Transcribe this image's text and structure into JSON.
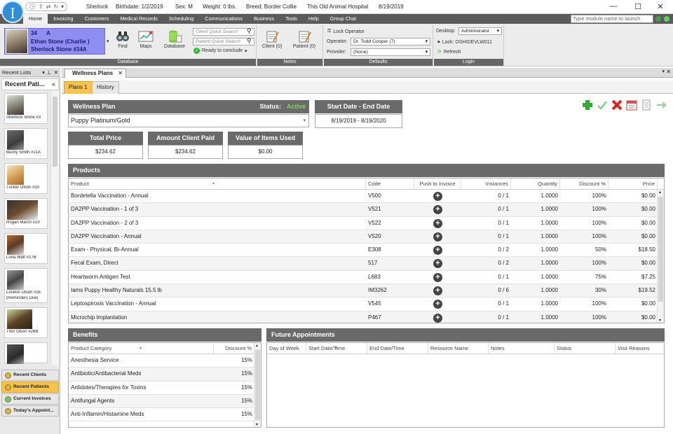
{
  "titlebar": {
    "logo": "I",
    "patient": "Sherlock",
    "birthdate": "Birthdate: 1/2/2019",
    "sex": "Sex: M",
    "weight": "Weight: 0 lbs.",
    "breed": "Breed: Border Collie",
    "hospital": "This Old Animal Hospital",
    "date": "8/19/2019",
    "minimize": "—",
    "maximize": "☐",
    "close": "✕"
  },
  "menu": {
    "items": [
      "Home",
      "Invoicing",
      "Customers",
      "Medical Records",
      "Scheduling",
      "Communications",
      "Business",
      "Tools",
      "Help",
      "Group Chat"
    ],
    "search_placeholder": "Type module name to launch"
  },
  "ribbon": {
    "patient_card": {
      "id": "34",
      "letter": "A",
      "client": "Ethan Stone (Charlie )",
      "patient": "Sherlock Stone #34A"
    },
    "find": "Find",
    "maps": "Maps",
    "database": "Database",
    "client_quick_search": "Client Quick Search",
    "patient_quick_search": "Patient Quick Search",
    "ready": "Ready to conclude",
    "database_group": "Database",
    "client_note": "Client (0)",
    "patient_note": "Patient (0)",
    "notes_group": "Notes",
    "lock_operator": "Lock Operator",
    "operator_label": "Operator:",
    "operator_value": "Dr. Todd Cooper (7)",
    "provider_label": "Provider:",
    "provider_value": "(None)",
    "defaults_group": "Defaults",
    "desktop_label": "Desktop:",
    "desktop_value": "Administrator",
    "lock_machine": "Lock: OSHIDEVLW011",
    "refresh": "Refresh",
    "login_group": "Login"
  },
  "left": {
    "recent_lists": "Recent Lists",
    "recent_patients_title": "Recent Pati...",
    "patients": [
      "Sherlock Stone #3",
      "Bucky Smith #21A",
      "Tucker Olson #20",
      "Rogan March #23",
      "Luna Watt #27B",
      "London Olson #2E",
      "Thor Olson #26B"
    ],
    "reminders": "(Reminders Due)",
    "nav": [
      "Recent Clients",
      "Recent Patients",
      "Current Invoices",
      "Today's Appoint..."
    ]
  },
  "doc": {
    "tab": "Wellness Plans",
    "subtabs": [
      "Plans 1",
      "History"
    ]
  },
  "plan": {
    "header": "Wellness Plan",
    "status_label": "Status:",
    "status_value": "Active",
    "plan_name": "Puppy Platinum/Gold",
    "dates_header": "Start Date - End Date",
    "dates": "8/19/2019 - 8/19/2020",
    "total_price_label": "Total Price",
    "total_price": "$234.62",
    "amount_paid_label": "Amount Client Paid",
    "amount_paid": "$234.62",
    "items_used_label": "Value of Items Used",
    "items_used": "$0.00"
  },
  "colors": {
    "status_active": "#7ed957",
    "accent_orange": "#f9c24a",
    "header_gray": "#6a6a6a"
  },
  "products": {
    "title": "Products",
    "columns": [
      "Product",
      "Code",
      "Push to Invoice",
      "Instances",
      "Quantity",
      "Discount %",
      "Price"
    ],
    "rows": [
      [
        "Bordetella Vaccination - Annual",
        "V500",
        "0 / 1",
        "1.0000",
        "100%",
        "$0.00"
      ],
      [
        "DA2PP Vaccination - 1 of 3",
        "V521",
        "0 / 1",
        "1.0000",
        "100%",
        "$0.00"
      ],
      [
        "DA2PP Vaccination - 2 of 3",
        "V522",
        "0 / 1",
        "1.0000",
        "100%",
        "$0.00"
      ],
      [
        "DA2PP Vaccination - Annual",
        "V520",
        "0 / 1",
        "1.0000",
        "100%",
        "$0.00"
      ],
      [
        "Exam - Physical, Bi-Annual",
        "E308",
        "0 / 2",
        "1.0000",
        "50%",
        "$18.50"
      ],
      [
        "Fecal Exam, Direct",
        "517",
        "0 / 2",
        "1.0000",
        "100%",
        "$0.00"
      ],
      [
        "Heartworm Antigen Test",
        "L683",
        "0 / 1",
        "1.0000",
        "75%",
        "$7.25"
      ],
      [
        "Iams Puppy Healthy Naturals 15.5 lb",
        "IM3262",
        "0 / 6",
        "1.0000",
        "30%",
        "$19.52"
      ],
      [
        "Leptospirosis Vaccination - Annual",
        "V545",
        "0 / 1",
        "1.0000",
        "100%",
        "$0.00"
      ],
      [
        "Microchip Implantation",
        "P467",
        "0 / 1",
        "1.0000",
        "100%",
        "$0.00"
      ]
    ]
  },
  "benefits": {
    "title": "Benefits",
    "columns": [
      "Product Category",
      "Discount %"
    ],
    "rows": [
      [
        "Anesthesia Service",
        "15%"
      ],
      [
        "Antibiotic/Antibacterial Meds",
        "15%"
      ],
      [
        "Antidotes/Therapies for Toxins",
        "15%"
      ],
      [
        "Antifungal Agents",
        "15%"
      ],
      [
        "Anti-Inflamm/Histamine Meds",
        "15%"
      ]
    ]
  },
  "appointments": {
    "title": "Future Appointments",
    "columns": [
      "Day of Week",
      "Start Date/Time",
      "End Date/Time",
      "Resource Name",
      "Notes",
      "Status",
      "Visit Reasons"
    ]
  }
}
